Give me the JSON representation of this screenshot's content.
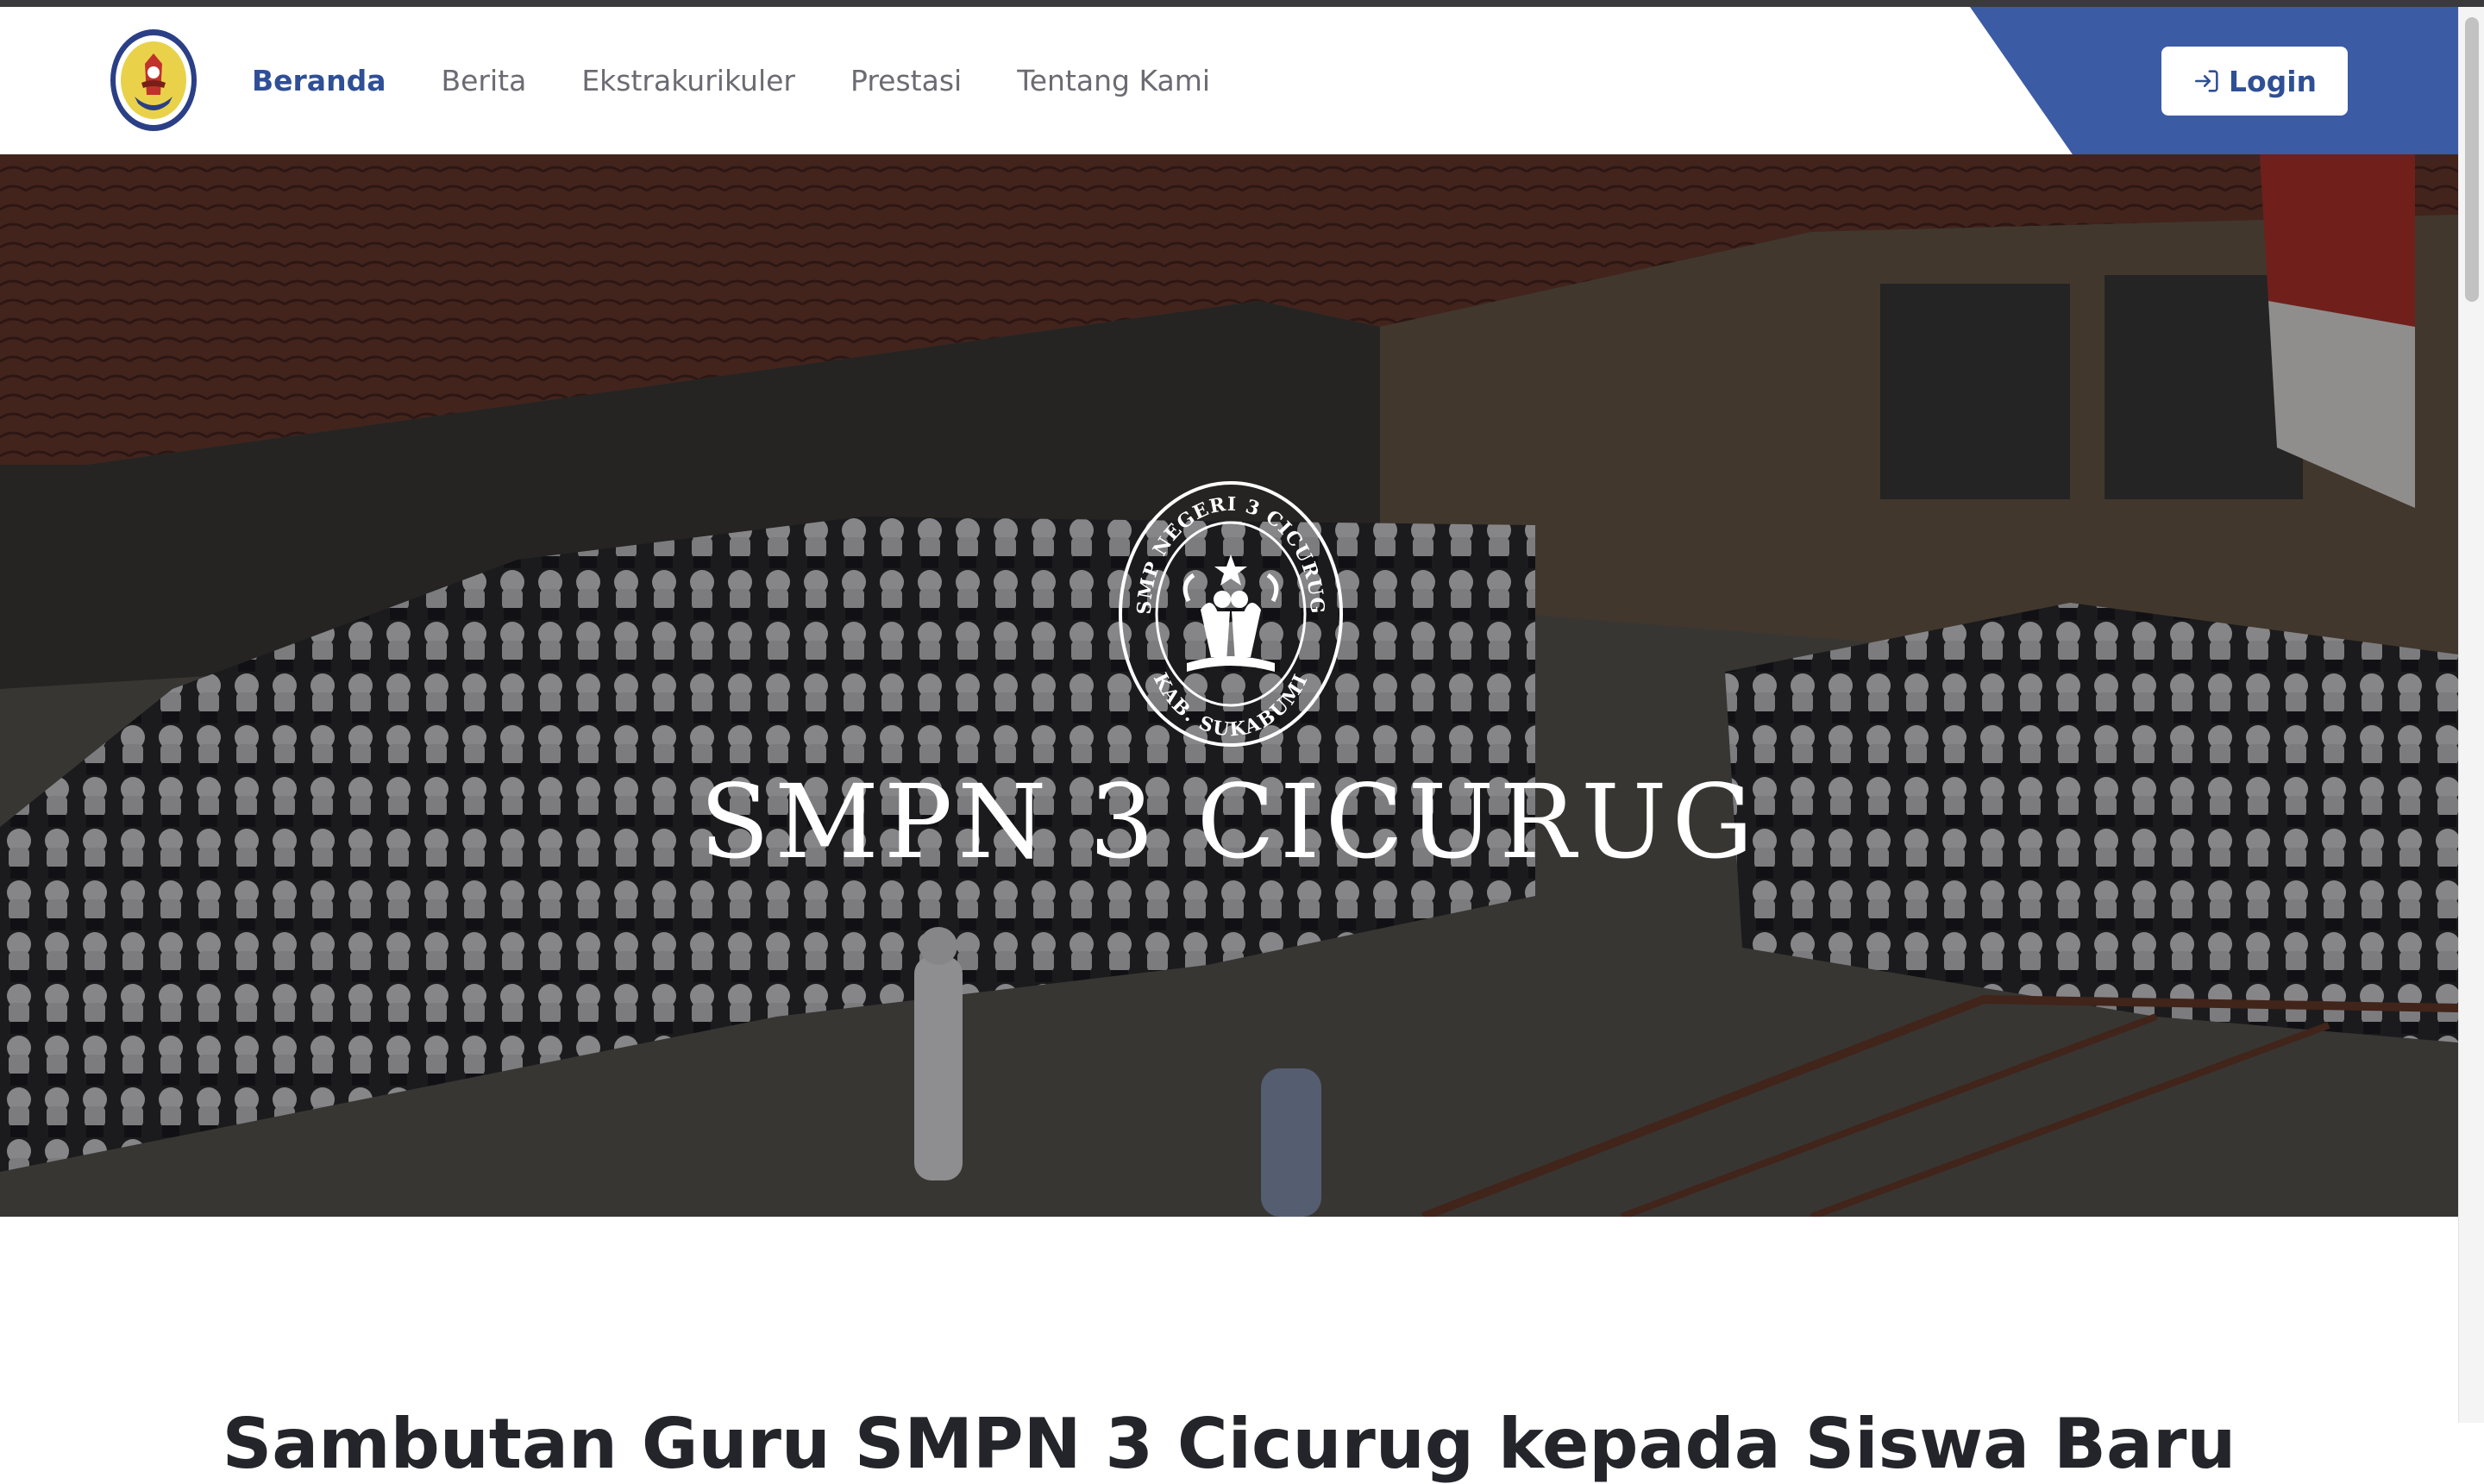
{
  "nav": {
    "items": [
      {
        "label": "Beranda",
        "active": true
      },
      {
        "label": "Berita",
        "active": false
      },
      {
        "label": "Ekstrakurikuler",
        "active": false
      },
      {
        "label": "Prestasi",
        "active": false
      },
      {
        "label": "Tentang Kami",
        "active": false
      }
    ],
    "login_label": "Login",
    "login_icon": "login-icon"
  },
  "hero": {
    "title": "SMPN 3 CICURUG",
    "emblem_top_text": "SMP NEGERI 3 CICURUG",
    "emblem_bottom_text": "KAB. SUKABUMI"
  },
  "section": {
    "title": "Sambutan Guru SMPN 3 Cicurug kepada Siswa Baru"
  },
  "colors": {
    "brand_blue": "#3b5ba5",
    "active_nav": "#2f4f96",
    "nav_text": "#6b6b73"
  }
}
